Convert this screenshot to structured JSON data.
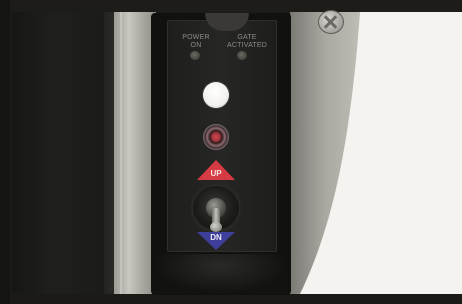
{
  "panel": {
    "power_label_line1": "POWER",
    "power_label_line2": "ON",
    "gate_label_line1": "GATE",
    "gate_label_line2": "ACTIVATED",
    "up_label": "UP",
    "down_label": "DN"
  },
  "colors": {
    "up_arrow": "#d63a42",
    "down_arrow": "#3e3f9b",
    "white_button": "#f2f1ee",
    "red_button": "#a1343c"
  },
  "icons": [
    "bolt-head-icon",
    "up-arrow-icon",
    "down-arrow-icon"
  ]
}
